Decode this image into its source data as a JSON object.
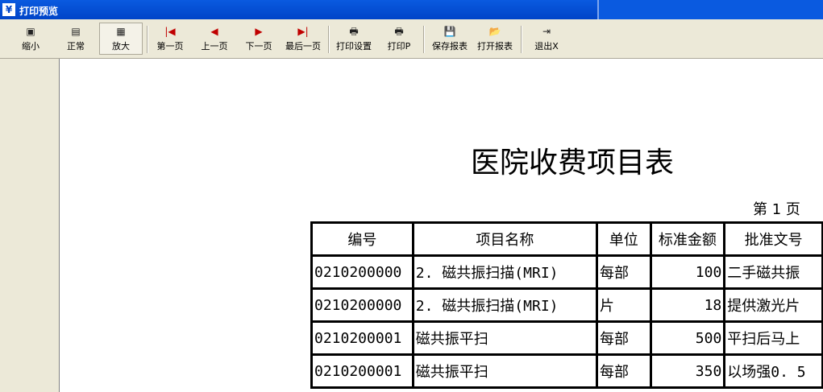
{
  "window": {
    "title": "打印预览",
    "icon": "app-icon"
  },
  "toolbar": {
    "buttons": [
      {
        "label": "缩小",
        "icon": "zoom-out-icon"
      },
      {
        "label": "正常",
        "icon": "normal-icon"
      },
      {
        "label": "放大",
        "icon": "zoom-in-icon"
      },
      {
        "label": "第一页",
        "icon": "first-page-icon"
      },
      {
        "label": "上一页",
        "icon": "prev-page-icon"
      },
      {
        "label": "下一页",
        "icon": "next-page-icon"
      },
      {
        "label": "最后一页",
        "icon": "last-page-icon"
      },
      {
        "label": "打印设置",
        "icon": "print-setup-icon"
      },
      {
        "label": "打印P",
        "icon": "printer-icon"
      },
      {
        "label": "保存报表",
        "icon": "save-icon"
      },
      {
        "label": "打开报表",
        "icon": "open-folder-icon"
      },
      {
        "label": "退出X",
        "icon": "exit-icon"
      }
    ]
  },
  "report": {
    "title": "医院收费项目表",
    "page_label": "第  1 页",
    "columns": [
      "编号",
      "项目名称",
      "单位",
      "标准金额",
      "批准文号"
    ],
    "rows": [
      [
        "0210200000",
        "2. 磁共振扫描(MRI)",
        "每部",
        "100",
        "二手磁共振"
      ],
      [
        "0210200000",
        "2. 磁共振扫描(MRI)",
        "片",
        "18",
        "提供激光片"
      ],
      [
        "0210200001",
        "磁共振平扫",
        "每部",
        "500",
        "平扫后马上"
      ],
      [
        "0210200001",
        "磁共振平扫",
        "每部",
        "350",
        "以场强0. 5"
      ]
    ]
  }
}
